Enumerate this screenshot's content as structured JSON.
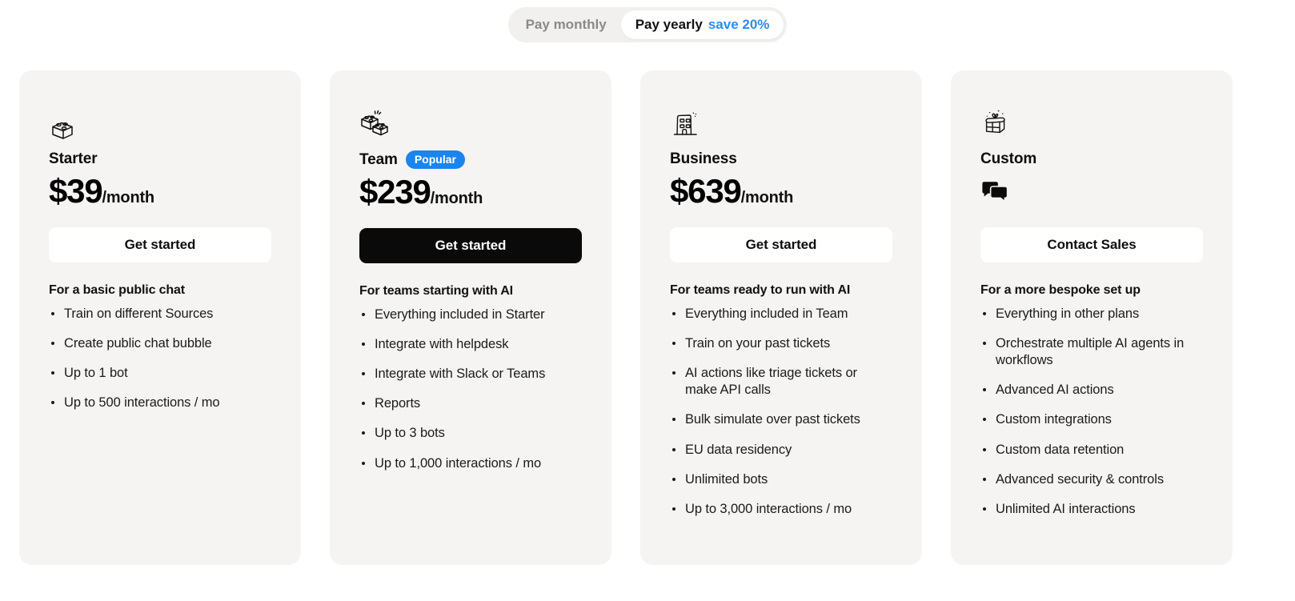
{
  "billing_toggle": {
    "monthly_label": "Pay monthly",
    "yearly_label": "Pay yearly",
    "yearly_save_label": "save 20%",
    "active": "yearly",
    "accent_color": "#2b8cf0"
  },
  "plans": [
    {
      "icon": "lego-brick-icon",
      "name": "Starter",
      "badge": null,
      "price_amount": "$39",
      "price_period": "/month",
      "cta_label": "Get started",
      "cta_style": "light",
      "tagline": "For a basic public chat",
      "features": [
        "Train on different Sources",
        "Create public chat bubble",
        "Up to 1 bot",
        "Up to 500 interactions / mo"
      ]
    },
    {
      "icon": "two-lego-bricks-icon",
      "name": "Team",
      "badge": "Popular",
      "badge_color": "#1a84ef",
      "price_amount": "$239",
      "price_period": "/month",
      "cta_label": "Get started",
      "cta_style": "dark",
      "tagline": "For teams starting with AI",
      "features": [
        "Everything included in Starter",
        "Integrate with helpdesk",
        "Integrate with Slack or Teams",
        "Reports",
        "Up to 3 bots",
        "Up to 1,000 interactions / mo"
      ]
    },
    {
      "icon": "office-building-icon",
      "name": "Business",
      "badge": null,
      "price_amount": "$639",
      "price_period": "/month",
      "cta_label": "Get started",
      "cta_style": "light",
      "tagline": "For teams ready to run with AI",
      "features": [
        "Everything included in Team",
        "Train on your past tickets",
        "AI actions like triage tickets or make API calls",
        "Bulk simulate over past tickets",
        "EU data residency",
        "Unlimited bots",
        "Up to 3,000 interactions / mo"
      ]
    },
    {
      "icon": "gift-box-icon",
      "name": "Custom",
      "badge": null,
      "price_amount": "",
      "price_period": "",
      "price_icon": "speech-bubbles-icon",
      "cta_label": "Contact Sales",
      "cta_style": "light",
      "tagline": "For a more bespoke set up",
      "features": [
        "Everything in other plans",
        "Orchestrate multiple AI agents in workflows",
        "Advanced AI actions",
        "Custom integrations",
        "Custom data retention",
        "Advanced security & controls",
        "Unlimited AI interactions"
      ]
    }
  ]
}
